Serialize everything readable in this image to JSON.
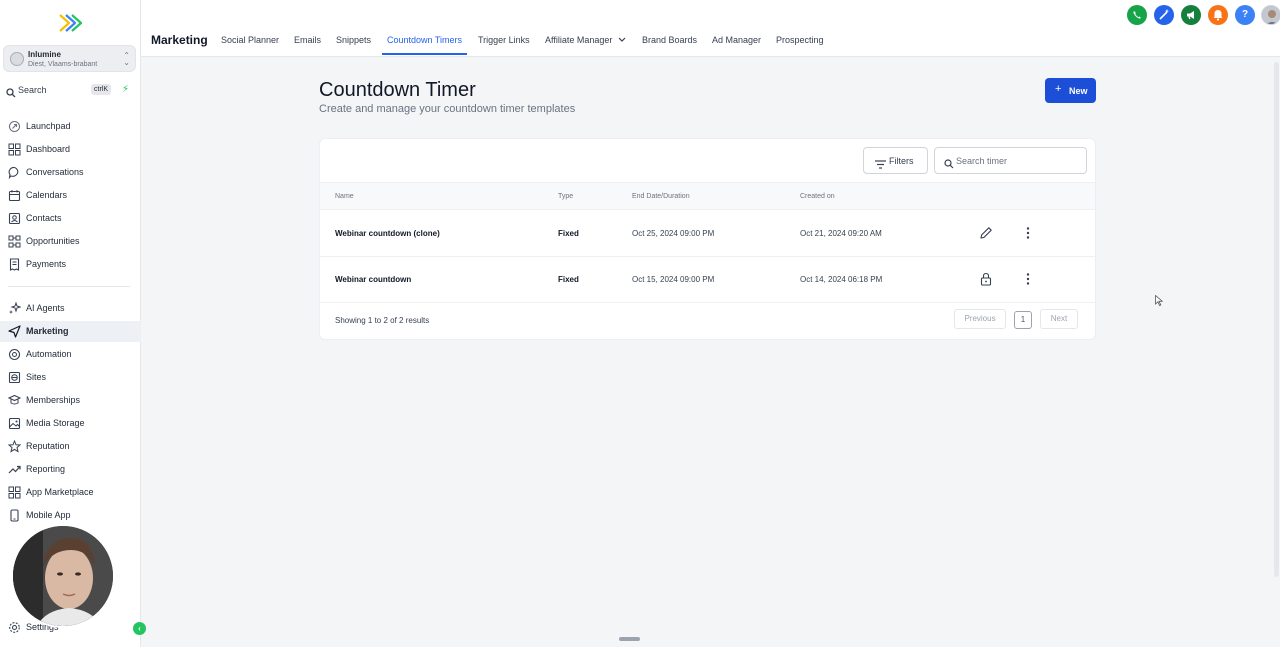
{
  "account": {
    "name": "Inlumine",
    "location": "Diest, Vlaams-brabant"
  },
  "search": {
    "label": "Search",
    "shortcut": "ctrlK"
  },
  "sidebar": {
    "items": [
      {
        "label": "Launchpad",
        "icon": "rocket-icon"
      },
      {
        "label": "Dashboard",
        "icon": "grid-icon"
      },
      {
        "label": "Conversations",
        "icon": "chat-icon"
      },
      {
        "label": "Calendars",
        "icon": "calendar-icon"
      },
      {
        "label": "Contacts",
        "icon": "contact-icon"
      },
      {
        "label": "Opportunities",
        "icon": "pipeline-icon"
      },
      {
        "label": "Payments",
        "icon": "receipt-icon"
      },
      {
        "label": "AI Agents",
        "icon": "sparkle-icon"
      },
      {
        "label": "Marketing",
        "icon": "send-icon",
        "active": true
      },
      {
        "label": "Automation",
        "icon": "automation-icon"
      },
      {
        "label": "Sites",
        "icon": "globe-icon"
      },
      {
        "label": "Memberships",
        "icon": "membership-icon"
      },
      {
        "label": "Media Storage",
        "icon": "image-icon"
      },
      {
        "label": "Reputation",
        "icon": "star-icon"
      },
      {
        "label": "Reporting",
        "icon": "trend-icon"
      },
      {
        "label": "App Marketplace",
        "icon": "apps-icon"
      },
      {
        "label": "Mobile App",
        "icon": "phone-icon"
      }
    ],
    "settings_label": "Settings"
  },
  "header": {
    "section": "Marketing",
    "tabs": [
      {
        "label": "Social Planner"
      },
      {
        "label": "Emails"
      },
      {
        "label": "Snippets"
      },
      {
        "label": "Countdown Timers",
        "active": true
      },
      {
        "label": "Trigger Links"
      },
      {
        "label": "Affiliate Manager"
      },
      {
        "label": "Brand Boards"
      },
      {
        "label": "Ad Manager"
      },
      {
        "label": "Prospecting"
      }
    ],
    "icons": [
      {
        "name": "phone-call-icon",
        "color": "#16a34a"
      },
      {
        "name": "magic-wand-icon",
        "color": "#2563eb"
      },
      {
        "name": "megaphone-icon",
        "color": "#15803d"
      },
      {
        "name": "bell-icon",
        "color": "#f97316"
      },
      {
        "name": "help-icon",
        "color": "#3b82f6"
      }
    ]
  },
  "page": {
    "title": "Countdown Timer",
    "subtitle": "Create and manage your countdown timer templates",
    "new_button": "New",
    "filters_button": "Filters",
    "search_placeholder": "Search timer"
  },
  "table": {
    "columns": [
      "Name",
      "Type",
      "End Date/Duration",
      "Created on"
    ],
    "rows": [
      {
        "name": "Webinar countdown (clone)",
        "type": "Fixed",
        "end": "Oct 25, 2024 09:00 PM",
        "created": "Oct 21, 2024 09:20 AM",
        "action_icon": "pencil-icon"
      },
      {
        "name": "Webinar countdown",
        "type": "Fixed",
        "end": "Oct 15, 2024 09:00 PM",
        "created": "Oct 14, 2024 06:18 PM",
        "action_icon": "lock-icon"
      }
    ],
    "summary": "Showing 1 to 2 of 2 results",
    "pagination": {
      "previous": "Previous",
      "page": "1",
      "next": "Next"
    }
  },
  "colors": {
    "accent": "#2563eb",
    "primary_button": "#1d4ed8",
    "sidebar_toggle": "#22c55e"
  }
}
